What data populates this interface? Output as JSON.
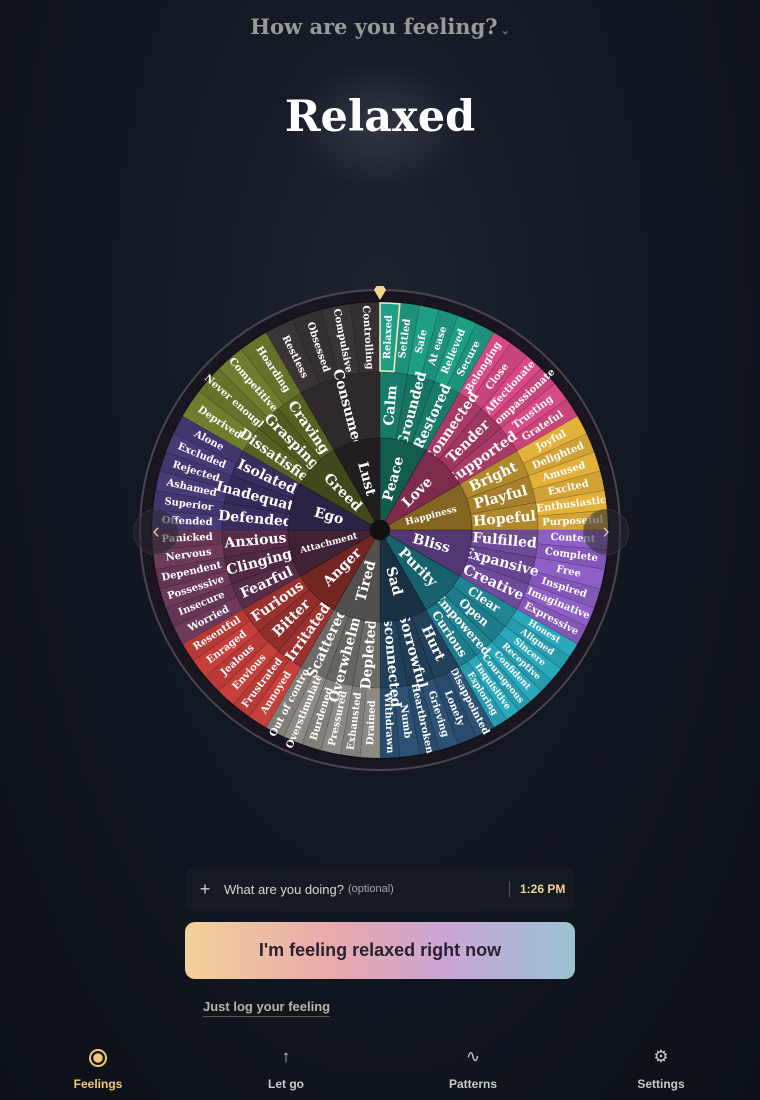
{
  "header": {
    "question": "How are you feeling?",
    "chevron": "⌄"
  },
  "current_feeling": "Relaxed",
  "wheel": {
    "selected": "Relaxed",
    "core": [
      {
        "name": "Peace",
        "color": "#1f9e86"
      },
      {
        "name": "Love",
        "color": "#d94a84"
      },
      {
        "name": "Happiness",
        "color": "#e3b03a"
      },
      {
        "name": "Bliss",
        "color": "#8e5fc7"
      },
      {
        "name": "Purity",
        "color": "#2aa9bd"
      },
      {
        "name": "Sad",
        "color": "#2d5274"
      },
      {
        "name": "Tired",
        "color": "#8d8a86"
      },
      {
        "name": "Anger",
        "color": "#c73f3b"
      },
      {
        "name": "Attachment",
        "color": "#6e3a5c"
      },
      {
        "name": "Ego",
        "color": "#4a3a78"
      },
      {
        "name": "Greed",
        "color": "#6e7d2e"
      },
      {
        "name": "Lust",
        "color": "#3b3437"
      }
    ],
    "middle": [
      [
        "Calm",
        "Grounded",
        "Restored"
      ],
      [
        "Connected",
        "Tender",
        "Supported"
      ],
      [
        "Bright",
        "Playful",
        "Hopeful"
      ],
      [
        "Fulfilled",
        "Expansive",
        "Creative"
      ],
      [
        "Clear",
        "Open",
        "Empowered",
        "Curious"
      ],
      [
        "Hurt",
        "Sorrowful",
        "Disconnected"
      ],
      [
        "Depleted",
        "Overwhelmed",
        "Scattered"
      ],
      [
        "Irritated",
        "Bitter",
        "Furious"
      ],
      [
        "Fearful",
        "Clinging",
        "Anxious"
      ],
      [
        "Defended",
        "Inadequate",
        "Isolated"
      ],
      [
        "Dissatisfied",
        "Grasping",
        "Craving"
      ],
      [
        "Consumed"
      ]
    ],
    "outer": [
      [
        "Relaxed",
        "Settled",
        "Safe",
        "At ease",
        "Relieved",
        "Secure"
      ],
      [
        "Belonging",
        "Close",
        "Affectionate",
        "Compassionate",
        "Trusting",
        "Grateful"
      ],
      [
        "Joyful",
        "Delighted",
        "Amused",
        "Excited",
        "Enthusiastic",
        "Purposeful"
      ],
      [
        "Content",
        "Complete",
        "Free",
        "Inspired",
        "Imaginative",
        "Expressive"
      ],
      [
        "Honest",
        "Aligned",
        "Sincere",
        "Receptive",
        "Confident",
        "Courageous",
        "Inquisitive",
        "Exploring"
      ],
      [
        "Disappointed",
        "Lonely",
        "Grieving",
        "Heartbroken",
        "Numb",
        "Withdrawn"
      ],
      [
        "Drained",
        "Exhausted",
        "Pressured",
        "Burdened",
        "Overstimulated",
        "Out of control"
      ],
      [
        "Annoyed",
        "Frustrated",
        "Envious",
        "Jealous",
        "Enraged",
        "Resentful"
      ],
      [
        "Worried",
        "Insecure",
        "Possessive",
        "Dependent",
        "Nervous",
        "Panicked"
      ],
      [
        "Offended",
        "Superior",
        "Ashamed",
        "Rejected",
        "Excluded",
        "Alone"
      ],
      [
        "Deprived",
        "Never enough",
        "Competitive",
        "Hoarding"
      ],
      [
        "Restless",
        "Obsessed",
        "Compulsive",
        "Controlling"
      ]
    ]
  },
  "nav": {
    "prev": "‹",
    "next": "›"
  },
  "activity": {
    "plus": "+",
    "placeholder": "What are you doing?",
    "optional": "(optional)",
    "time": "1:26 PM"
  },
  "cta_label": "I'm feeling relaxed right now",
  "just_log_label": "Just log your feeling",
  "tabs": [
    {
      "label": "Feelings",
      "icon": "feelings-icon"
    },
    {
      "label": "Let go",
      "icon": "arrow-up-icon",
      "glyph": "↑"
    },
    {
      "label": "Patterns",
      "icon": "wave-icon",
      "glyph": "∿"
    },
    {
      "label": "Settings",
      "icon": "gear-icon",
      "glyph": "⚙"
    }
  ]
}
